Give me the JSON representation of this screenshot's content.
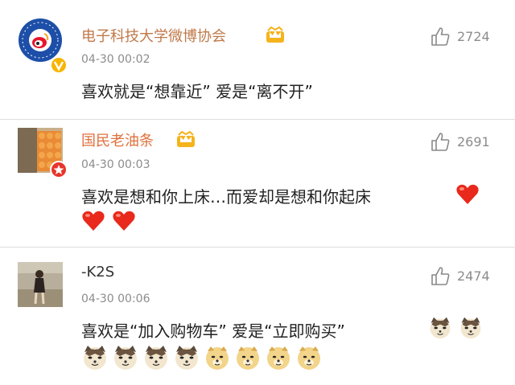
{
  "comments": [
    {
      "username": "电子科技大学微博协会",
      "username_color": "#c0794a",
      "time": "04-30 00:02",
      "text": "喜欢就是“想靠近” 爱是“离不开”",
      "likes": "2724",
      "avatar_icon": "weibo-logo-avatar",
      "badge": "verified-v-icon",
      "vip_icon": "crown-vip-icon",
      "emojis": []
    },
    {
      "username": "国民老油条",
      "username_color": "#e0703c",
      "time": "04-30 00:03",
      "text": "喜欢是想和你上床…而爱却是想和你起床",
      "likes": "2691",
      "avatar_icon": "photo-avatar",
      "badge": "star-badge-icon",
      "vip_icon": "crown-vip-icon",
      "emojis": [
        "heart",
        "heart",
        "heart"
      ]
    },
    {
      "username": "-K2S",
      "username_color": "#333333",
      "time": "04-30 00:06",
      "text": "喜欢是“加入购物车”  爱是“立即购买”",
      "likes": "2474",
      "avatar_icon": "photo-avatar",
      "badge": "",
      "vip_icon": "",
      "emojis": [
        "doge-cat",
        "doge-cat",
        "doge-cat",
        "doge-cat",
        "doge-cat",
        "doge",
        "doge",
        "doge",
        "doge",
        "doge"
      ]
    }
  ]
}
